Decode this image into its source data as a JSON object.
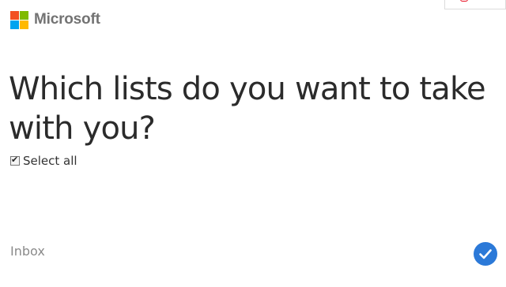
{
  "header": {
    "brand_name": "Microsoft",
    "logo_colors": [
      "#f25022",
      "#7fba00",
      "#00a4ef",
      "#ffb900"
    ],
    "top_right_icon": "office-icon"
  },
  "main": {
    "title": "Which lists do you want to take with you?",
    "select_all": {
      "label": "Select all",
      "checked": true
    },
    "lists": [
      {
        "name": "Inbox",
        "selected": true,
        "selected_icon": "checkmark-circle-icon",
        "accent_color": "#2b79d8"
      }
    ]
  }
}
